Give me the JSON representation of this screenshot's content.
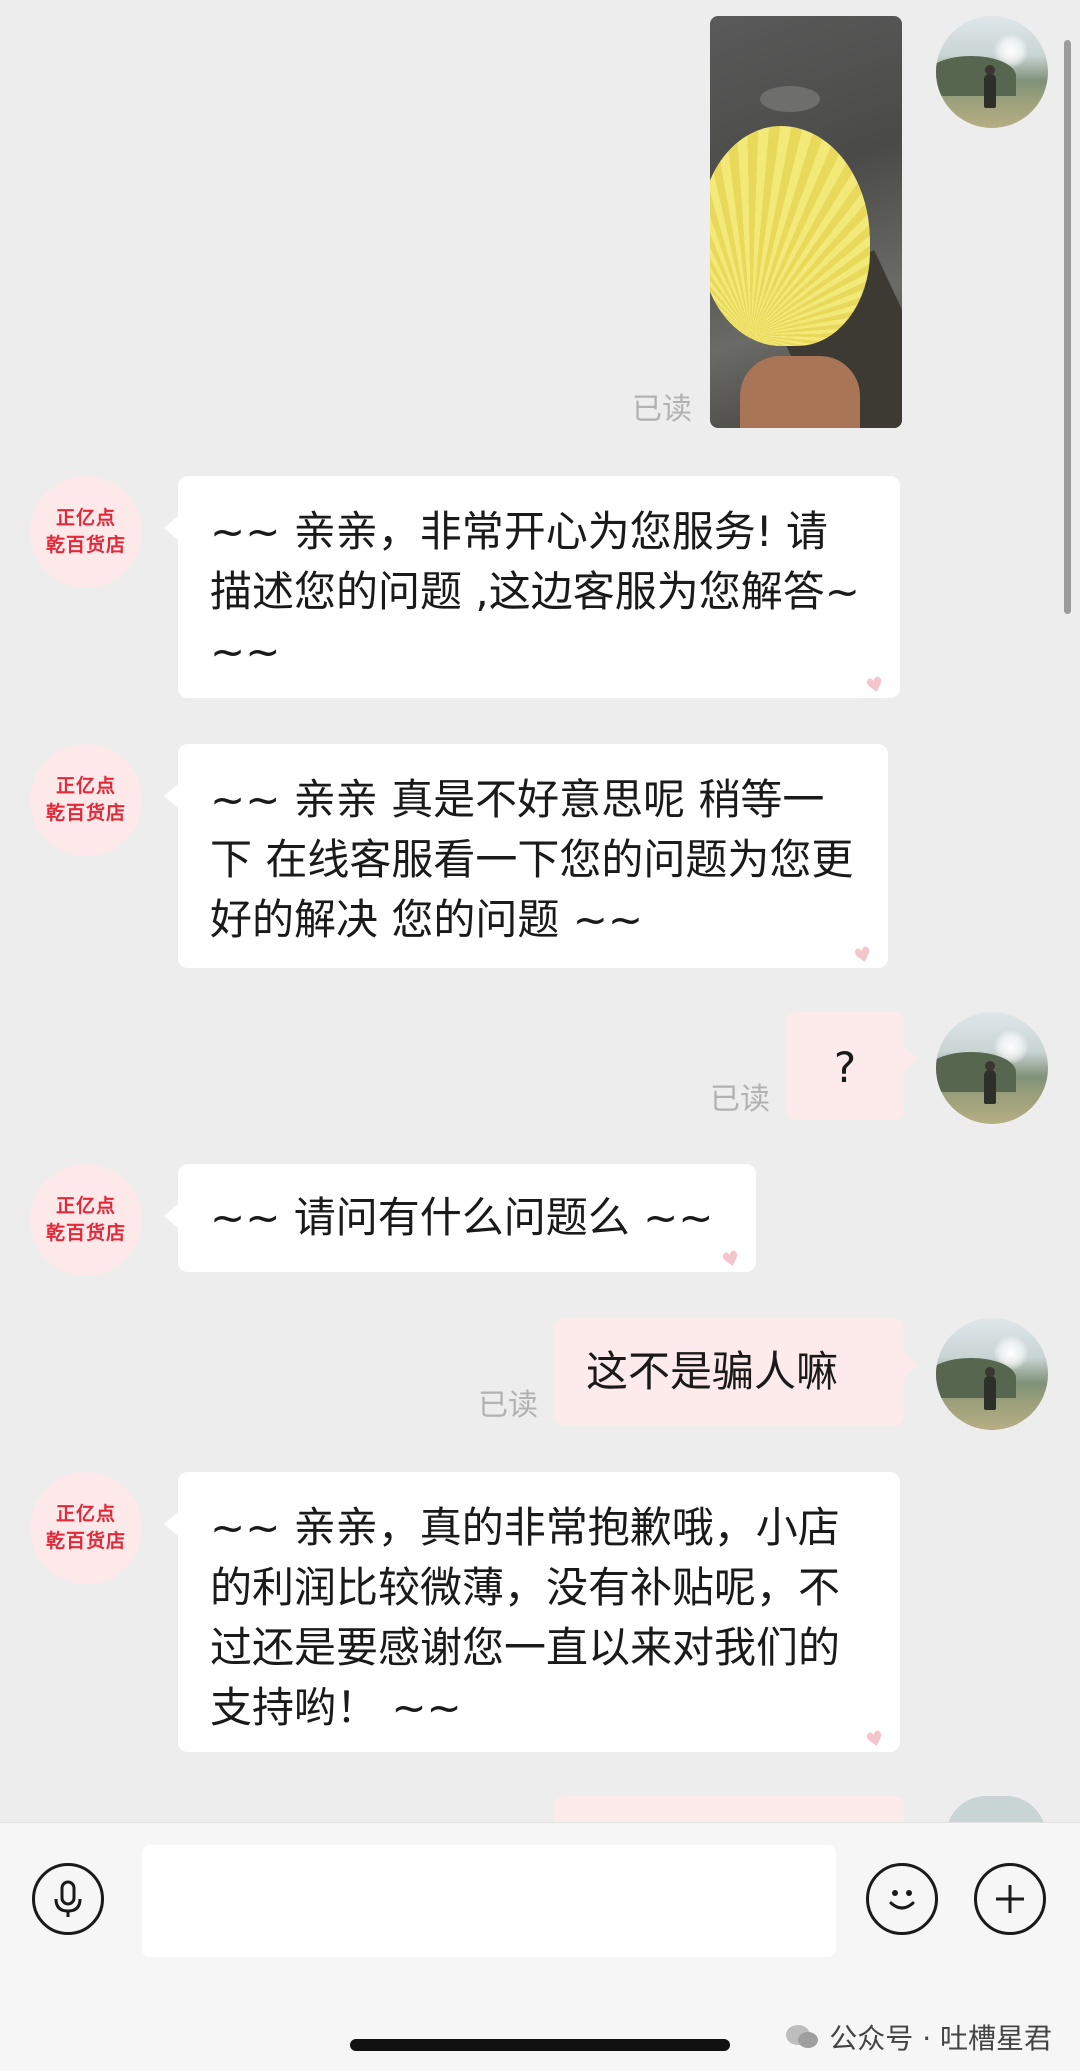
{
  "messages": {
    "m1": {
      "read": "已读"
    },
    "m2": {
      "avatar_line1": "正亿点",
      "avatar_line2": "乾百货店",
      "text": "~~ 亲亲，非常开心为您服务! 请描述您的问题 ,这边客服为您解答~ ~~"
    },
    "m3": {
      "avatar_line1": "正亿点",
      "avatar_line2": "乾百货店",
      "text": "~~ 亲亲  真是不好意思呢 稍等一下  在线客服看一下您的问题为您更好的解决 您的问题 ~~"
    },
    "m4": {
      "text": "?",
      "read": "已读"
    },
    "m5": {
      "avatar_line1": "正亿点",
      "avatar_line2": "乾百货店",
      "text": "~~ 请问有什么问题么 ~~"
    },
    "m6": {
      "text": "这不是骗人嘛",
      "read": "已读"
    },
    "m7": {
      "avatar_line1": "正亿点",
      "avatar_line2": "乾百货店",
      "text": "~~ 亲亲，真的非常抱歉哦，小店的利润比较微薄，没有补贴呢，不过还是要感谢您一直以来对我们的支持哟！  ~~"
    }
  },
  "watermark": "公众号 · 吐槽星君",
  "icons": {
    "voice": "microphone-icon",
    "emoji": "smiley-icon",
    "plus": "plus-icon"
  }
}
